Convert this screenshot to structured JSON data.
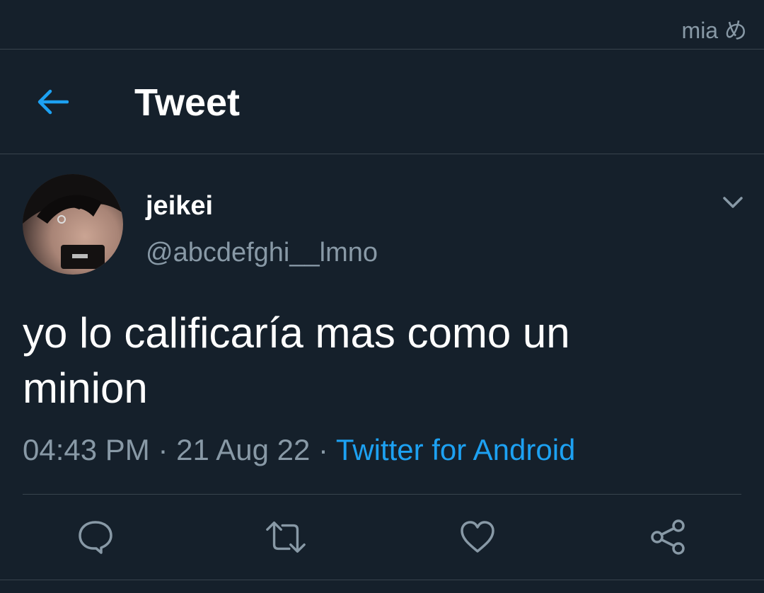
{
  "status_bar": {
    "carrier_text": "mia め"
  },
  "header": {
    "back_icon": "arrow-left-icon",
    "title": "Tweet"
  },
  "tweet": {
    "display_name": "jeikei",
    "handle": "@abcdefghi__lmno",
    "text": "yo lo calificaría mas como un\nminion",
    "time": "04:43 PM",
    "separator": "·",
    "date": "21 Aug 22",
    "source": "Twitter for Android"
  },
  "actions": [
    {
      "name": "reply",
      "icon": "comment-icon"
    },
    {
      "name": "retweet",
      "icon": "retweet-icon"
    },
    {
      "name": "like",
      "icon": "heart-icon"
    },
    {
      "name": "share",
      "icon": "share-icon"
    }
  ],
  "colors": {
    "background": "#15202b",
    "accent": "#1da1f2",
    "secondary_text": "#8899a6",
    "divider": "#38444d"
  }
}
